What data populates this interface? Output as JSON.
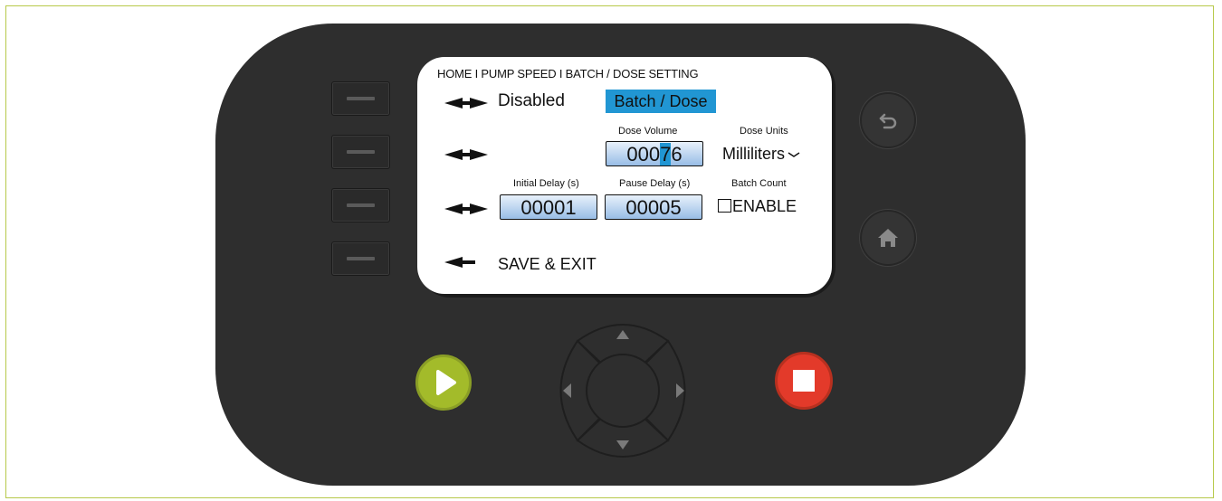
{
  "screen": {
    "breadcrumb": "HOME I PUMP SPEED I BATCH / DOSE SETTING",
    "mode_row": {
      "option_disabled": "Disabled",
      "option_selected": "Batch / Dose"
    },
    "dose_row": {
      "dose_volume_label": "Dose Volume",
      "dose_volume_prefix": "000",
      "dose_volume_highlight": "7",
      "dose_volume_suffix": "6",
      "dose_units_label": "Dose Units",
      "dose_units_value": "Milliliters"
    },
    "delay_row": {
      "initial_delay_label": "Initial Delay (s)",
      "initial_delay_value": "00001",
      "pause_delay_label": "Pause Delay (s)",
      "pause_delay_value": "00005",
      "batch_count_label": "Batch Count",
      "batch_count_checkbox_label": "ENABLE",
      "batch_count_checked": false
    },
    "save_exit_label": "SAVE & EXIT"
  },
  "colors": {
    "device_body": "#2e2e2e",
    "selection_blue": "#2196d3",
    "play_green": "#a3bb2a",
    "stop_red": "#e33a2a",
    "frame_border": "#b7c94a"
  },
  "icons": {
    "softkeys": [
      "softkey-bar-icon",
      "softkey-bar-icon",
      "softkey-bar-icon",
      "softkey-bar-icon"
    ],
    "right_buttons": [
      "back-arrow-icon",
      "home-icon"
    ],
    "dpad": [
      "up-arrow-icon",
      "left-arrow-icon",
      "right-arrow-icon",
      "down-arrow-icon"
    ],
    "play": "play-icon",
    "stop": "stop-icon"
  }
}
